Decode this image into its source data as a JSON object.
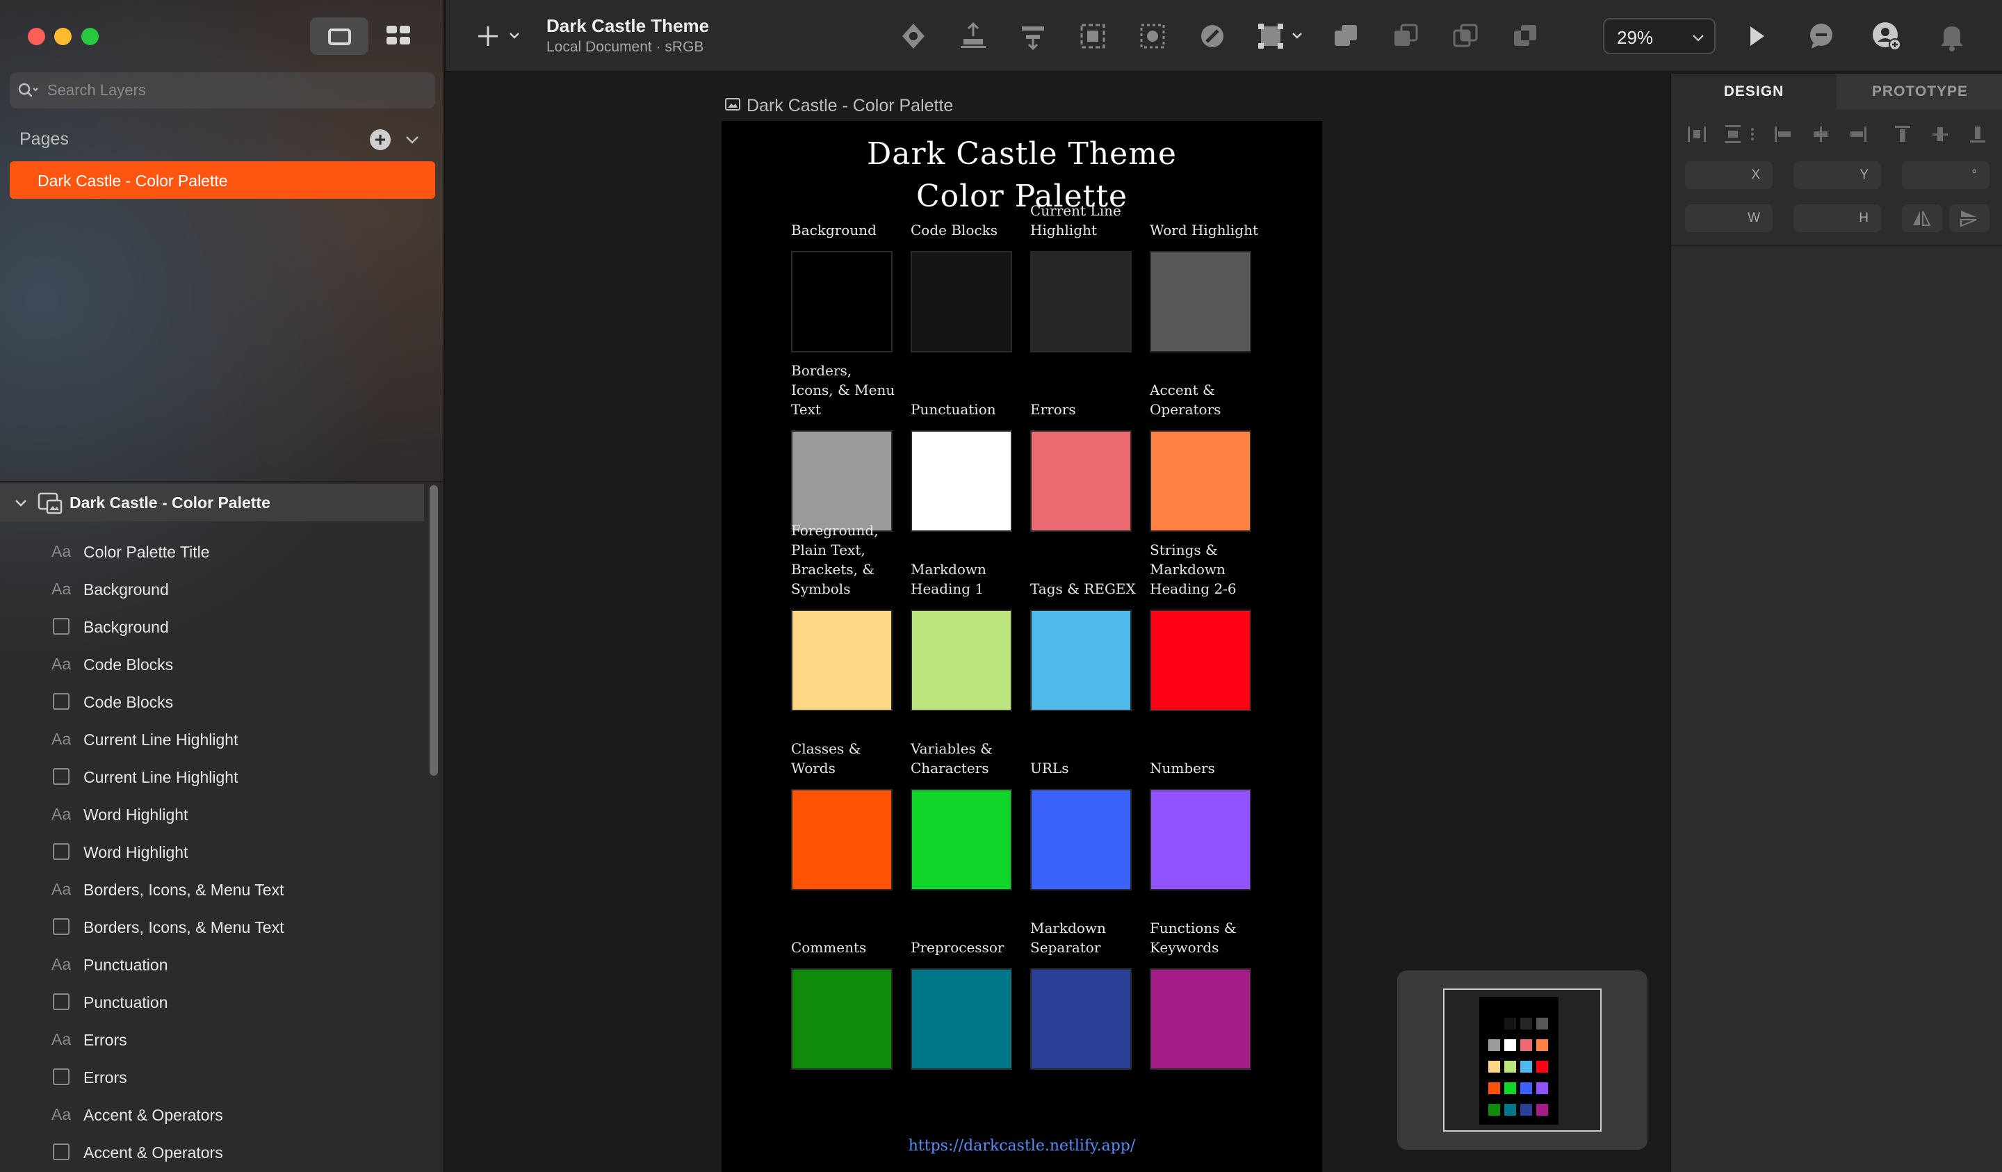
{
  "window": {
    "title": "Dark Castle Theme",
    "subtitle": "Local Document · sRGB"
  },
  "sidebar": {
    "search_placeholder": "Search Layers",
    "pages_label": "Pages",
    "pages": [
      {
        "name": "Dark Castle - Color Palette",
        "selected": true
      }
    ],
    "artboard": "Dark Castle - Color Palette",
    "layers": [
      {
        "kind": "text",
        "name": "Color Palette Title"
      },
      {
        "kind": "text",
        "name": "Background"
      },
      {
        "kind": "rect",
        "name": "Background"
      },
      {
        "kind": "text",
        "name": "Code Blocks"
      },
      {
        "kind": "rect",
        "name": "Code Blocks"
      },
      {
        "kind": "text",
        "name": "Current Line Highlight"
      },
      {
        "kind": "rect",
        "name": "Current Line Highlight"
      },
      {
        "kind": "text",
        "name": "Word Highlight"
      },
      {
        "kind": "rect",
        "name": "Word Highlight"
      },
      {
        "kind": "text",
        "name": "Borders, Icons, & Menu Text"
      },
      {
        "kind": "rect",
        "name": "Borders, Icons, & Menu Text"
      },
      {
        "kind": "text",
        "name": "Punctuation"
      },
      {
        "kind": "rect",
        "name": "Punctuation"
      },
      {
        "kind": "text",
        "name": "Errors"
      },
      {
        "kind": "rect",
        "name": "Errors"
      },
      {
        "kind": "text",
        "name": "Accent & Operators"
      },
      {
        "kind": "rect",
        "name": "Accent & Operators"
      }
    ],
    "text_layer_glyph": "Aa"
  },
  "toolbar": {
    "zoom": "29%",
    "icons": [
      "create-symbol-icon",
      "forward-backward-icon",
      "align-icon",
      "scale-icon",
      "mask-icon",
      "flatten-icon",
      "resize-icon",
      "union-icon",
      "subtract-icon",
      "intersect-icon",
      "difference-icon"
    ],
    "right_icons": [
      "play-icon",
      "comment-icon",
      "add-collaborator-icon",
      "notifications-icon"
    ]
  },
  "canvas": {
    "artboard_title": "Dark Castle - Color Palette",
    "palette_title_line1": "Dark Castle Theme",
    "palette_title_line2": "Color Palette",
    "url": "https://darkcastle.netlify.app/",
    "swatches": [
      {
        "label": "Background",
        "color": "#000000"
      },
      {
        "label": "Code Blocks",
        "color": "#151515"
      },
      {
        "label": "Current Line\nHighlight",
        "color": "#262626"
      },
      {
        "label": "Word Highlight",
        "color": "#575757"
      },
      {
        "label": "Borders,\nIcons, & Menu\nText",
        "color": "#9a9a9a"
      },
      {
        "label": "Punctuation",
        "color": "#ffffff"
      },
      {
        "label": "Errors",
        "color": "#ec6a71"
      },
      {
        "label": "Accent &\nOperators",
        "color": "#ff8243"
      },
      {
        "label": "Foreground,\nPlain Text,\nBrackets, &\nSymbols",
        "color": "#ffd785"
      },
      {
        "label": "Markdown\nHeading 1",
        "color": "#bde57e"
      },
      {
        "label": "Tags & REGEX",
        "color": "#4ebaec"
      },
      {
        "label": "Strings &\nMarkdown\nHeading 2-6",
        "color": "#ff0014"
      },
      {
        "label": "Classes &\nWords",
        "color": "#fe5305"
      },
      {
        "label": "Variables &\nCharacters",
        "color": "#10d62a"
      },
      {
        "label": "URLs",
        "color": "#3c62fe"
      },
      {
        "label": "Numbers",
        "color": "#9053ff"
      },
      {
        "label": "Comments",
        "color": "#0f8a0a"
      },
      {
        "label": "Preprocessor",
        "color": "#00788a"
      },
      {
        "label": "Markdown\nSeparator",
        "color": "#2b3f96"
      },
      {
        "label": "Functions &\nKeywords",
        "color": "#a31c88"
      }
    ]
  },
  "inspector": {
    "tabs": [
      "DESIGN",
      "PROTOTYPE"
    ],
    "fields": {
      "x": "X",
      "y": "Y",
      "rotation": "°",
      "w": "W",
      "h": "H"
    }
  }
}
